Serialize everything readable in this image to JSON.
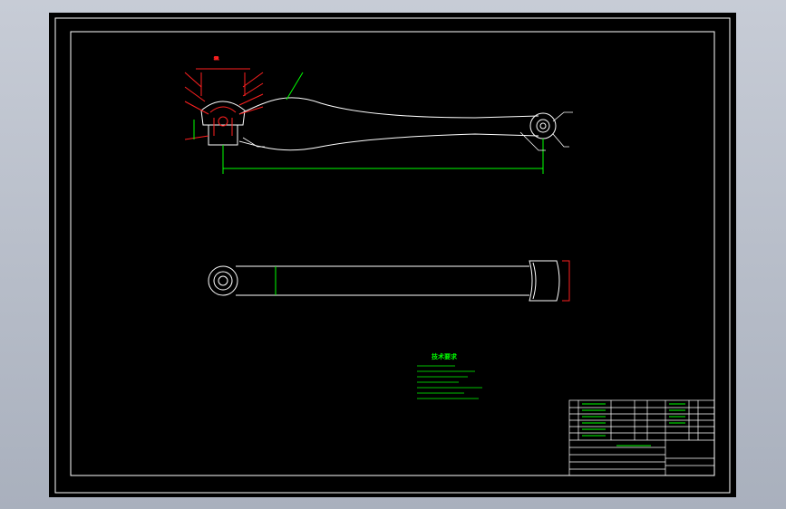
{
  "drawing": {
    "colors": {
      "background": "#000000",
      "outline": "#ffffff",
      "dimension": "#00ff00",
      "section": "#ff2020",
      "annotation": "#ffffff"
    },
    "notes": {
      "heading": "技术要求",
      "lines": [
        "1.",
        "2.",
        "3.",
        "4.",
        "5.",
        "6.",
        "7."
      ]
    }
  }
}
